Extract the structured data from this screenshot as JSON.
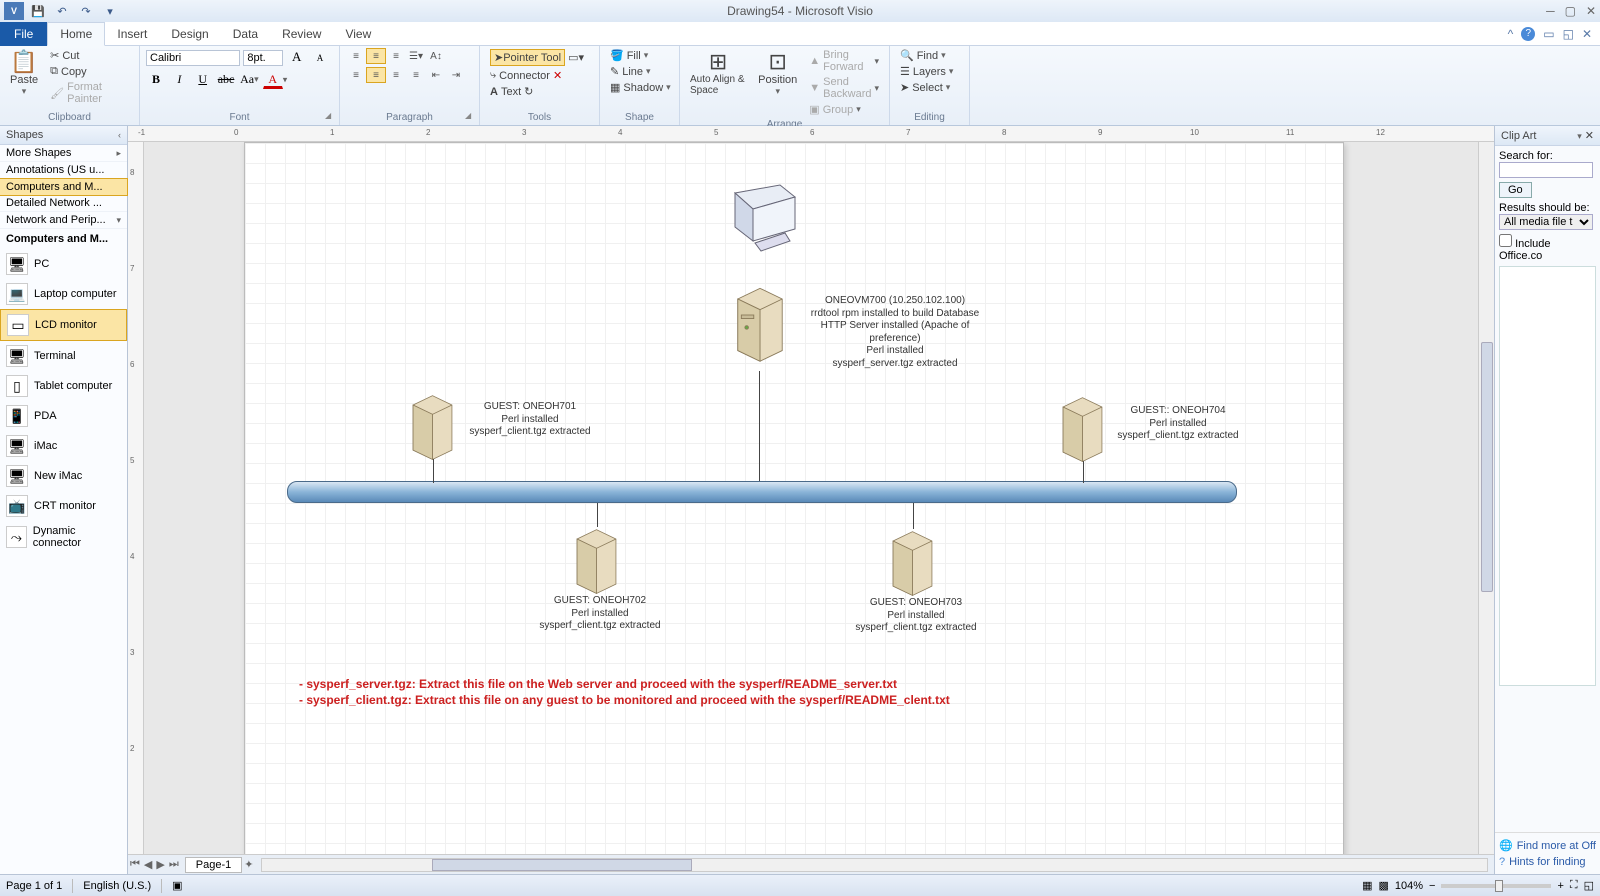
{
  "app": {
    "title": "Drawing54 - Microsoft Visio"
  },
  "qat": {
    "save": "💾",
    "undo": "↶",
    "redo": "↷"
  },
  "tabs": {
    "file": "File",
    "home": "Home",
    "insert": "Insert",
    "design": "Design",
    "data": "Data",
    "review": "Review",
    "view": "View"
  },
  "ribbon": {
    "clipboard": {
      "label": "Clipboard",
      "paste": "Paste",
      "cut": "Cut",
      "copy": "Copy",
      "fmt": "Format Painter"
    },
    "font": {
      "label": "Font",
      "name": "Calibri",
      "size": "8pt."
    },
    "paragraph": {
      "label": "Paragraph"
    },
    "tools": {
      "label": "Tools",
      "pointer": "Pointer Tool",
      "connector": "Connector",
      "text": "Text"
    },
    "shape": {
      "label": "Shape",
      "fill": "Fill",
      "line": "Line",
      "shadow": "Shadow"
    },
    "arrange": {
      "label": "Arrange",
      "autoalign": "Auto Align & Space",
      "position": "Position",
      "fwd": "Bring Forward",
      "back": "Send Backward",
      "group": "Group"
    },
    "editing": {
      "label": "Editing",
      "find": "Find",
      "layers": "Layers",
      "select": "Select"
    }
  },
  "shapesPane": {
    "title": "Shapes",
    "more": "More Shapes",
    "sets": {
      "annotations": "Annotations (US u...",
      "computers": "Computers and M...",
      "detailed": "Detailed Network ...",
      "network": "Network and Perip..."
    },
    "category": "Computers and M...",
    "stencils": {
      "pc": "PC",
      "laptop": "Laptop computer",
      "lcd": "LCD monitor",
      "terminal": "Terminal",
      "tablet": "Tablet computer",
      "pda": "PDA",
      "imac": "iMac",
      "newimac": "New iMac",
      "crt": "CRT monitor",
      "dyn": "Dynamic connector"
    }
  },
  "diagram": {
    "server_main": "ONEOVM700 (10.250.102.100)\nrrdtool rpm installed to build Database\nHTTP Server installed (Apache of preference)\nPerl installed\nsysperf_server.tgz extracted",
    "g701": "GUEST: ONEOH701\nPerl installed\nsysperf_client.tgz extracted",
    "g702": "GUEST: ONEOH702\nPerl installed\nsysperf_client.tgz extracted",
    "g703": "GUEST: ONEOH703\nPerl installed\nsysperf_client.tgz extracted",
    "g704": "GUEST:: ONEOH704\nPerl installed\nsysperf_client.tgz extracted",
    "note1": "- sysperf_server.tgz: Extract this file on the Web server and proceed with the sysperf/README_server.txt",
    "note2": "- sysperf_client.tgz: Extract this file on any guest to be monitored and proceed with the   sysperf/README_clent.txt"
  },
  "clipart": {
    "title": "Clip Art",
    "searchfor": "Search for:",
    "go": "Go",
    "resultsLabel": "Results should be:",
    "resultsValue": "All media file t",
    "includeOffice": "Include Office.co",
    "findmore": "Find more at Off",
    "hints": "Hints for finding"
  },
  "pageTabs": {
    "page1": "Page-1"
  },
  "status": {
    "page": "Page 1 of 1",
    "lang": "English (U.S.)",
    "zoom": "104%"
  }
}
